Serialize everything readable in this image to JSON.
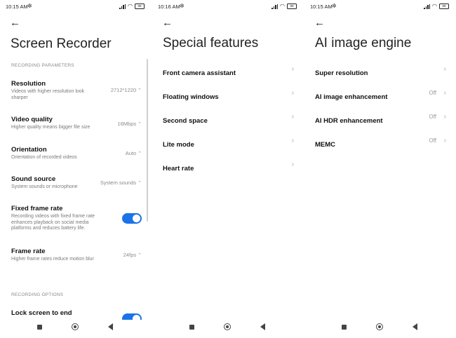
{
  "screen1": {
    "status": {
      "time": "10:15 AM",
      "battery": "89"
    },
    "title": "Screen Recorder",
    "section_params": "RECORDING PARAMETERS",
    "section_options": "RECORDING OPTIONS",
    "rows": [
      {
        "label": "Resolution",
        "sub": "Videos with higher resolution look sharper",
        "value": "2712*1220"
      },
      {
        "label": "Video quality",
        "sub": "Higher quality means bigger file size",
        "value": "16Mbps"
      },
      {
        "label": "Orientation",
        "sub": "Orientation of recorded videos",
        "value": "Auto"
      },
      {
        "label": "Sound source",
        "sub": "System sounds or microphone",
        "value": "System sounds"
      },
      {
        "label": "Fixed frame rate",
        "sub": "Recording videos with fixed frame rate enhances playback on social media platforms and reduces battery life.",
        "value": ""
      },
      {
        "label": "Frame rate",
        "sub": "Higher frame rates reduce motion blur",
        "value": "24fps"
      },
      {
        "label": "Lock screen to end",
        "sub": "",
        "value": ""
      }
    ]
  },
  "screen2": {
    "status": {
      "time": "10:16 AM",
      "battery": "89"
    },
    "title": "Special features",
    "items": [
      "Front camera assistant",
      "Floating windows",
      "Second space",
      "Lite mode",
      "Heart rate"
    ]
  },
  "screen3": {
    "status": {
      "time": "10:15 AM",
      "battery": "89"
    },
    "title": "AI image engine",
    "items": [
      {
        "label": "Super resolution",
        "value": ""
      },
      {
        "label": "AI image enhancement",
        "value": "Off"
      },
      {
        "label": "AI HDR enhancement",
        "value": "Off"
      },
      {
        "label": "MEMC",
        "value": "Off"
      }
    ]
  },
  "icons": {
    "back": "back-arrow-icon",
    "chevron": "chevron-right-icon",
    "updown": "up-down-chevron-icon",
    "settings": "gear-icon"
  },
  "colors": {
    "toggle_on": "#1a73e8"
  }
}
